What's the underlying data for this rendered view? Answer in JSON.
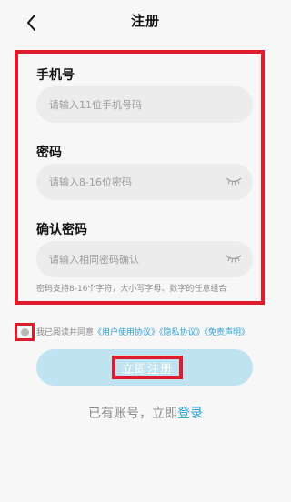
{
  "header": {
    "title": "注册",
    "back_icon": "chevron-left-icon"
  },
  "form": {
    "phone_label": "手机号",
    "phone_placeholder": "请输入11位手机号码",
    "password_label": "密码",
    "password_placeholder": "请输入8-16位密码",
    "confirm_label": "确认密码",
    "confirm_placeholder": "请输入相同密码确认",
    "hint": "密码支持8-16个字符，大小写字母、数字的任意组合",
    "eye_icon": "eye-closed-icon"
  },
  "agreement": {
    "prefix": "我已阅读并同意",
    "user_agreement": "《用户使用协议》",
    "privacy": "《隐私协议》",
    "disclaimer": "《免责声明》",
    "checked": false
  },
  "register_button": {
    "label": "立即注册"
  },
  "login": {
    "prefix": "已有账号，立即",
    "link": "登录"
  },
  "colors": {
    "accent": "#2aa0d8",
    "button_bg": "#bfe3f1",
    "highlight": "#e01b2c",
    "input_bg": "#ececec"
  }
}
